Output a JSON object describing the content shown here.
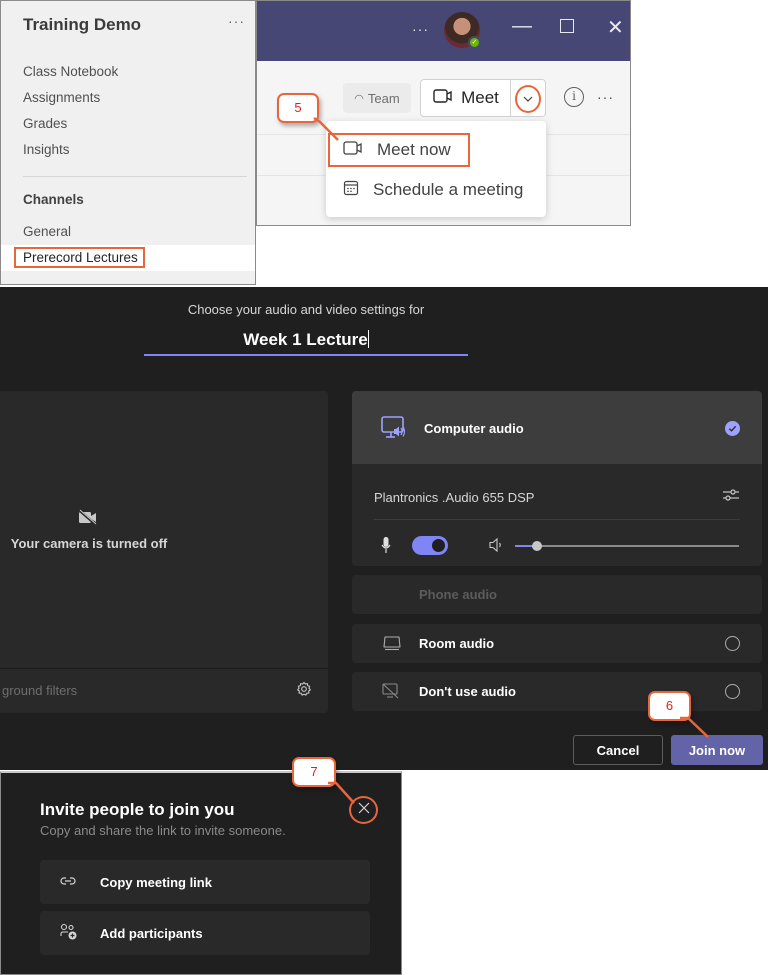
{
  "sidebar": {
    "team_name": "Training Demo",
    "more_icon": "ellipsis-icon",
    "nav_items": [
      {
        "label": "Class Notebook"
      },
      {
        "label": "Assignments"
      },
      {
        "label": "Grades"
      },
      {
        "label": "Insights"
      }
    ],
    "section_label": "Channels",
    "channels": [
      {
        "label": "General",
        "selected": false
      },
      {
        "label": "Prerecord Lectures",
        "selected": true
      }
    ]
  },
  "teams_header": {
    "titlebar_color": "#464775",
    "window_controls": [
      "minimize-icon",
      "maximize-icon",
      "close-icon"
    ],
    "toolbar": {
      "team_chip_label": "Team",
      "meet_label": "Meet"
    },
    "meet_dropdown": {
      "items": [
        {
          "label": "Meet now",
          "icon": "video-camera-icon",
          "highlighted": true
        },
        {
          "label": "Schedule a meeting",
          "icon": "calendar-icon",
          "highlighted": false
        }
      ]
    }
  },
  "callouts": {
    "step5": "5",
    "step6": "6",
    "step7": "7",
    "color": "#e8663c"
  },
  "prejoin": {
    "subtitle": "Choose your audio and video settings for",
    "meeting_title": "Week 1 Lecture",
    "camera_status": "Your camera is turned off",
    "background_filters_label": "ground filters",
    "audio_options": {
      "computer_audio": {
        "label": "Computer audio",
        "selected": true
      },
      "device_name": "Plantronics .Audio 655 DSP",
      "mic_enabled": true,
      "speaker_volume_percent": 10,
      "phone_audio": {
        "label": "Phone audio",
        "disabled": true
      },
      "room_audio": {
        "label": "Room audio",
        "selected": false
      },
      "no_audio": {
        "label": "Don't use audio",
        "selected": false
      }
    },
    "buttons": {
      "cancel": "Cancel",
      "join": "Join now"
    },
    "accent_color": "#7f85f5",
    "join_color": "#6264a7"
  },
  "invite": {
    "title": "Invite people to join you",
    "subtitle": "Copy and share the link to invite someone.",
    "actions": [
      {
        "label": "Copy meeting link",
        "icon": "link-icon"
      },
      {
        "label": "Add participants",
        "icon": "add-people-icon"
      }
    ]
  }
}
